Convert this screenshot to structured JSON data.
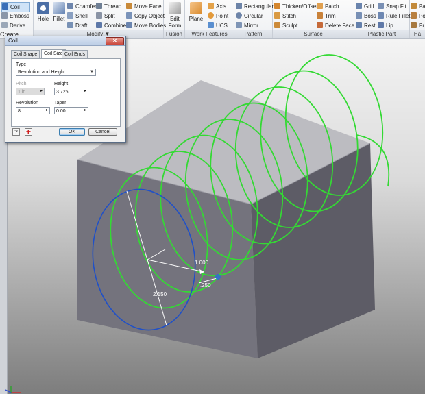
{
  "ribbon": {
    "groups": [
      {
        "label": "Create",
        "items": [
          "Coil",
          "Emboss",
          "Derive"
        ]
      },
      {
        "label": "Modify",
        "big_items": [
          "Hole",
          "Fillet"
        ],
        "items": [
          "Chamfer",
          "Shell",
          "Draft",
          "Thread",
          "Split",
          "Combine",
          "Move Face",
          "Copy Object",
          "Move Bodies"
        ]
      },
      {
        "label": "Fusion",
        "big_items": [
          "Edit Form"
        ]
      },
      {
        "label": "Work Features",
        "big_items": [
          "Plane"
        ],
        "items": [
          "Axis",
          "Point",
          "UCS"
        ]
      },
      {
        "label": "Pattern",
        "items": [
          "Rectangular",
          "Circular",
          "Mirror"
        ]
      },
      {
        "label": "Surface",
        "items": [
          "Thicken/Offset",
          "Stitch",
          "Sculpt",
          "Patch",
          "Trim",
          "Delete Face"
        ]
      },
      {
        "label": "Plastic Part",
        "items": [
          "Grill",
          "Boss",
          "Rest",
          "Snap Fit",
          "Rule Fillet",
          "Lip"
        ]
      },
      {
        "label": "Ha",
        "items": [
          "Pa",
          "Po",
          "Pr"
        ]
      }
    ],
    "modify_label": "Modify ▼"
  },
  "dialog": {
    "title": "Coil",
    "close_label": "✕",
    "tabs": [
      "Coil Shape",
      "Coil Size",
      "Coil Ends"
    ],
    "active_tab": "Coil Size",
    "type_label": "Type",
    "type_value": "Revolution and Height",
    "pitch_label": "Pitch",
    "pitch_value": "1 in",
    "height_label": "Height",
    "height_value": "3.725",
    "revolution_label": "Revolution",
    "revolution_value": "8",
    "taper_label": "Taper",
    "taper_value": "0.00",
    "ok_label": "OK",
    "cancel_label": "Cancel",
    "help_icon": "help-icon",
    "add_icon": "add-icon"
  },
  "viewport": {
    "dimensions": [
      "1.000",
      "2.150",
      ".250"
    ],
    "coil_color": "#34d934",
    "profile_color": "#1f50c8",
    "box_top_color": "#bdbdc1",
    "box_side_color": "#6f6f78"
  }
}
